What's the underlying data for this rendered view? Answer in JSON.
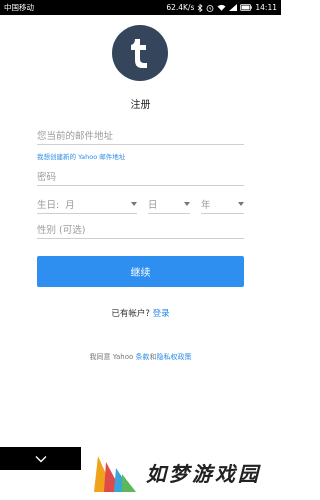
{
  "status_bar": {
    "carrier": "中国移动",
    "speed": "62.4K/s",
    "battery": "",
    "time": "14:11"
  },
  "logo": {
    "letter": "t",
    "brand_color": "#35465c"
  },
  "form": {
    "title": "注册",
    "email_placeholder": "您当前的邮件地址",
    "yahoo_hint": "我想创建新的 Yahoo 邮件地址",
    "password_placeholder": "密码",
    "birthday_label": "生日:",
    "month_placeholder": "月",
    "day_placeholder": "日",
    "year_placeholder": "年",
    "gender_placeholder": "性别 (可选)",
    "continue_label": "继续",
    "continue_color": "#2f8ff1"
  },
  "signin": {
    "prompt": "已有帐户?",
    "link": "登录"
  },
  "terms": {
    "prefix": "我同意 Yahoo ",
    "terms_link": "条款",
    "and": "和",
    "privacy_link": "隐私权政策"
  },
  "nav": {
    "back_icon": "chevron-down-icon"
  },
  "watermark": {
    "text": "如梦游戏园"
  }
}
